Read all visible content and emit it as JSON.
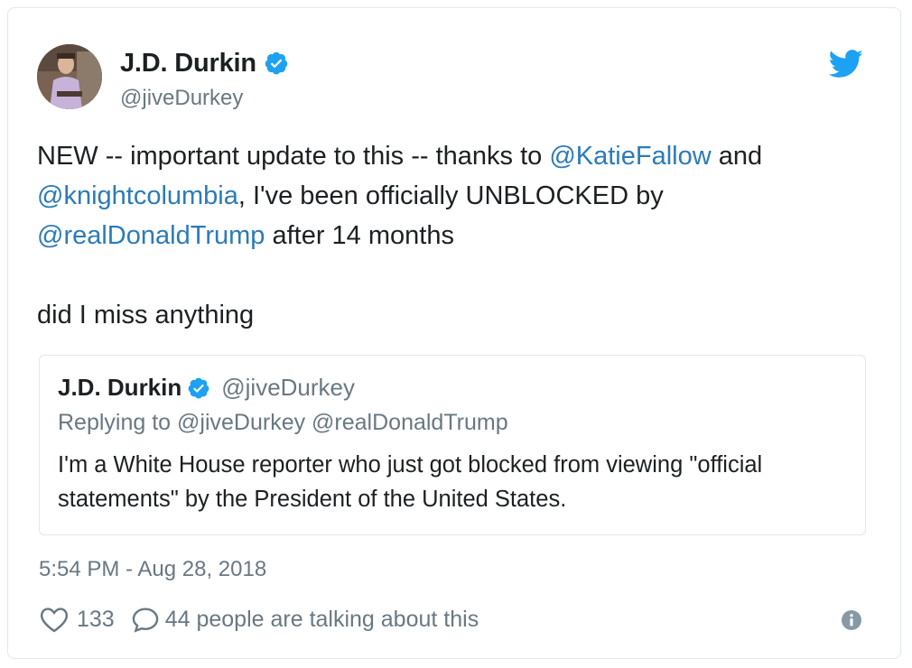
{
  "tweet": {
    "author": {
      "name": "J.D. Durkin",
      "handle": "@jiveDurkey"
    },
    "body": {
      "line1_prefix": "NEW -- important update to this -- thanks to ",
      "mention1": "@KatieFallow",
      "line1_suffix": " and",
      "mention2": "@knightcolumbia",
      "line2_suffix": ", I've been officially UNBLOCKED by",
      "mention3": "@realDonaldTrump",
      "line3_suffix": " after 14 months",
      "line4": "did I miss anything"
    },
    "quote": {
      "name": "J.D. Durkin",
      "handle": "@jiveDurkey",
      "replying_to": "Replying to @jiveDurkey @realDonaldTrump",
      "text": "I'm a White House reporter who just got blocked from viewing \"official statements\" by the President of the United States."
    },
    "timestamp": "5:54 PM - Aug 28, 2018",
    "likes": "133",
    "talking": "44 people are talking about this"
  },
  "icons": {
    "brand_color": "#1da1f2",
    "mention_color": "#2b7bb9",
    "verified": "verified-badge-icon",
    "bird": "twitter-bird-icon",
    "heart": "heart-icon",
    "reply": "reply-bubble-icon",
    "info": "info-icon"
  }
}
